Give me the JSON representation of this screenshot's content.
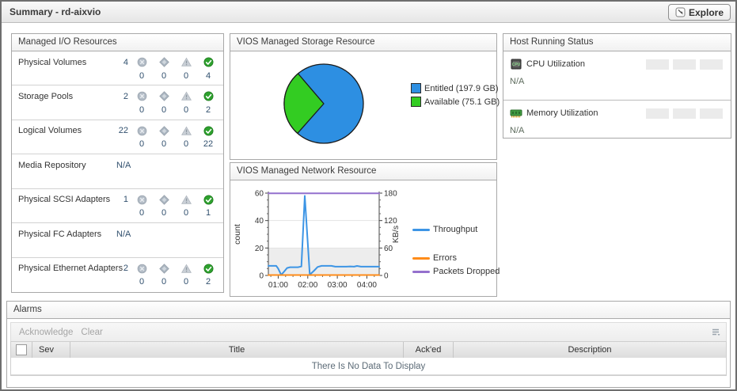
{
  "header": {
    "title": "Summary -  rd-aixvio",
    "explore_label": "Explore"
  },
  "io_panel": {
    "title": "Managed I/O Resources",
    "severity_icons": [
      "fatal-icon",
      "critical-icon",
      "warning-icon",
      "normal-icon"
    ],
    "rows": [
      {
        "label": "Physical Volumes",
        "total": "4",
        "counts": [
          "0",
          "0",
          "0",
          "4"
        ]
      },
      {
        "label": "Storage Pools",
        "total": "2",
        "counts": [
          "0",
          "0",
          "0",
          "2"
        ]
      },
      {
        "label": "Logical Volumes",
        "total": "22",
        "counts": [
          "0",
          "0",
          "0",
          "22"
        ]
      },
      {
        "label": "Media Repository",
        "total": "N/A"
      },
      {
        "label": "Physical SCSI Adapters",
        "total": "1",
        "counts": [
          "0",
          "0",
          "0",
          "1"
        ]
      },
      {
        "label": "Physical FC Adapters",
        "total": "N/A"
      },
      {
        "label": "Physical Ethernet Adapters",
        "total": "2",
        "counts": [
          "0",
          "0",
          "0",
          "2"
        ]
      }
    ]
  },
  "storage_panel": {
    "title": "VIOS Managed Storage Resource"
  },
  "network_panel": {
    "title": "VIOS Managed Network Resource"
  },
  "host_panel": {
    "title": "Host Running Status",
    "rows": [
      {
        "icon": "cpu-icon",
        "label": "CPU Utilization",
        "value": "N/A"
      },
      {
        "icon": "memory-icon",
        "label": "Memory Utilization",
        "value": "N/A"
      }
    ]
  },
  "alarms": {
    "title": "Alarms",
    "acknowledge_label": "Acknowledge",
    "clear_label": "Clear",
    "columns": [
      "Sev",
      "Title",
      "Ack'ed",
      "Description"
    ],
    "empty_message": "There Is No Data To Display"
  },
  "chart_data": [
    {
      "type": "pie",
      "title": "VIOS Managed Storage Resource",
      "slices": [
        {
          "label": "Entitled (197.9 GB)",
          "value": 197.9,
          "color": "#2d8fe2"
        },
        {
          "label": "Available (75.1 GB)",
          "value": 75.1,
          "color": "#33cc22"
        }
      ],
      "legend_position": "right",
      "outline_color": "#1b1b1b"
    },
    {
      "type": "line",
      "title": "VIOS Managed Network Resource",
      "ylabel_left": "count",
      "yticks_left": [
        0,
        20,
        40,
        60
      ],
      "ylim_left": [
        0,
        60
      ],
      "ylabel_right": "KB/s",
      "yticks_right": [
        0,
        60,
        120,
        180
      ],
      "ylim_right": [
        0,
        180
      ],
      "x_range_minutes": [
        40,
        265
      ],
      "xticks_minutes": [
        60,
        120,
        180,
        240
      ],
      "xtick_labels": [
        "01:00",
        "02:00",
        "03:00",
        "04:00"
      ],
      "band_left_units": [
        0,
        20
      ],
      "band_color": "#ededed",
      "grid": true,
      "legend_position": "right",
      "series": [
        {
          "name": "Throughput",
          "axis": "left-count (right axis = x3 KB/s)",
          "color": "#3d95e5",
          "points": [
            [
              40,
              7
            ],
            [
              56,
              7
            ],
            [
              60,
              5
            ],
            [
              66,
              0.4
            ],
            [
              72,
              2.8
            ],
            [
              78,
              5.4
            ],
            [
              84,
              6
            ],
            [
              100,
              6
            ],
            [
              107,
              6.5
            ],
            [
              114,
              58
            ],
            [
              124,
              0.6
            ],
            [
              132,
              3.2
            ],
            [
              140,
              6.2
            ],
            [
              148,
              7
            ],
            [
              168,
              7
            ],
            [
              176,
              6.4
            ],
            [
              198,
              6.4
            ],
            [
              206,
              6.6
            ],
            [
              214,
              6.4
            ],
            [
              220,
              6.9
            ],
            [
              228,
              6.4
            ],
            [
              250,
              6.4
            ],
            [
              265,
              6.4
            ]
          ]
        },
        {
          "name": "Errors",
          "axis": "left-count",
          "color": "#ff8c19",
          "points": [
            [
              40,
              0.3
            ],
            [
              265,
              0.3
            ]
          ]
        },
        {
          "name": "Packets  Dropped",
          "axis": "left-count",
          "color": "#9470cd",
          "points": [
            [
              40,
              59.8
            ],
            [
              265,
              59.8
            ]
          ]
        }
      ]
    }
  ]
}
